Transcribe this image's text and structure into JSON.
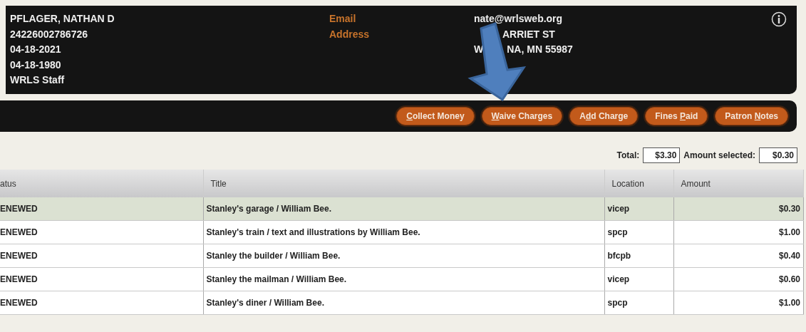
{
  "patron": {
    "lines": [
      "PFLAGER, NATHAN D",
      "24226002786726",
      "04-18-2021",
      "04-18-1980",
      "WRLS Staff"
    ],
    "fields": [
      {
        "label": "Email",
        "values": [
          [
            "nate@wrlsweb.org"
          ]
        ]
      },
      {
        "label": "Address",
        "values": [
          [
            "ARRIET ST"
          ],
          [
            "W",
            "NA, MN 55987"
          ]
        ]
      }
    ]
  },
  "toolbar": {
    "buttons": [
      {
        "parts": [
          {
            "text": "C",
            "underlined": true
          },
          {
            "text": "ollect Money",
            "underlined": false
          }
        ]
      },
      {
        "parts": [
          {
            "text": "W",
            "underlined": true
          },
          {
            "text": "aive Charges",
            "underlined": false
          }
        ]
      },
      {
        "parts": [
          {
            "text": "A",
            "underlined": false
          },
          {
            "text": "d",
            "underlined": true
          },
          {
            "text": "d Charge",
            "underlined": false
          }
        ]
      },
      {
        "parts": [
          {
            "text": "Fines ",
            "underlined": false
          },
          {
            "text": "P",
            "underlined": true
          },
          {
            "text": "aid",
            "underlined": false
          }
        ]
      },
      {
        "parts": [
          {
            "text": "Patron ",
            "underlined": false
          },
          {
            "text": "N",
            "underlined": true
          },
          {
            "text": "otes",
            "underlined": false
          }
        ]
      }
    ]
  },
  "totals": {
    "total_label": "Total:",
    "total": "$3.30",
    "selected_label": "Amount selected:",
    "selected": "$0.30"
  },
  "table": {
    "columns": [
      "atus",
      "Title",
      "Location",
      "Amount"
    ],
    "rows": [
      {
        "selected": true,
        "cells": [
          "ENEWED",
          "Stanley's garage / William Bee.",
          "vicep",
          "$0.30"
        ]
      },
      {
        "selected": false,
        "cells": [
          "ENEWED",
          "Stanley's train / text and illustrations by William Bee.",
          "spcp",
          "$1.00"
        ]
      },
      {
        "selected": false,
        "cells": [
          "ENEWED",
          "Stanley the builder / William Bee.",
          "bfcpb",
          "$0.40"
        ]
      },
      {
        "selected": false,
        "cells": [
          "ENEWED",
          "Stanley the mailman / William Bee.",
          "vicep",
          "$0.60"
        ]
      },
      {
        "selected": false,
        "cells": [
          "ENEWED",
          "Stanley's diner / William Bee.",
          "spcp",
          "$1.00"
        ]
      }
    ]
  }
}
